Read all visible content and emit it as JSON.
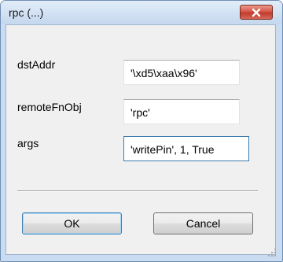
{
  "window": {
    "title": "rpc (...)"
  },
  "form": {
    "fields": [
      {
        "label": "dstAddr",
        "value": "'\\xd5\\xaa\\x96'"
      },
      {
        "label": "remoteFnObj",
        "value": "'rpc'"
      },
      {
        "label": "args",
        "value": "'writePin', 1, True"
      }
    ]
  },
  "buttons": {
    "ok": "OK",
    "cancel": "Cancel"
  },
  "icons": {
    "close": "close-icon",
    "grip": "resize-grip-icon"
  },
  "colors": {
    "close_button": "#c94434",
    "client_bg": "#f0f0f0",
    "frame": "#c9dcf1"
  }
}
